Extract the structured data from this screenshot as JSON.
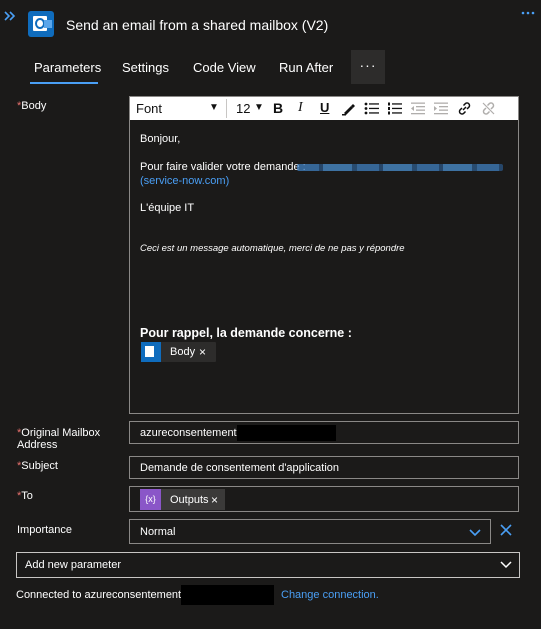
{
  "header": {
    "title": "Send an email from a shared mailbox (V2)",
    "expand_icon": "double-chevron-right-icon",
    "app_icon": "outlook-icon",
    "more_icon": "ellipsis-icon"
  },
  "tabs": [
    {
      "label": "Parameters",
      "active": true
    },
    {
      "label": "Settings",
      "active": false
    },
    {
      "label": "Code View",
      "active": false
    },
    {
      "label": "Run After",
      "active": false
    }
  ],
  "tabs_more_label": "···",
  "labels": {
    "required_marker": "*",
    "body": "Body",
    "mailbox": "Original Mailbox Address",
    "subject": "Subject",
    "to": "To",
    "importance": "Importance"
  },
  "toolbar": {
    "font": "Font",
    "size": "12",
    "bold": "B",
    "italic": "I",
    "underline": "U"
  },
  "body_content": {
    "greeting": "Bonjour,",
    "line_prefix": "Pour faire valider votre demande :",
    "link_text": "(service-now.com)",
    "signature": "L'équipe IT",
    "auto_note": "Ceci est un message automatique, merci de ne pas y répondre",
    "reminder": "Pour rappel, la demande concerne :",
    "token_label": "Body",
    "token_close": "×"
  },
  "fields": {
    "mailbox_value": "azureconsentement@",
    "subject_value": "Demande de consentement d'application",
    "to_token_label": "Outputs",
    "to_token_icon": "{x}",
    "to_token_close": "×",
    "importance_value": "Normal",
    "importance_clear": "✕"
  },
  "add_parameter": {
    "label": "Add new parameter"
  },
  "connection": {
    "prefix": "Connected to azureconsentement@",
    "link": "Change connection."
  },
  "colors": {
    "background": "#1b1a19",
    "accent": "#4a9ff5",
    "required": "#e8716d",
    "outlook_blue": "#0f6cbd",
    "expression_purple": "#8a56c8"
  }
}
